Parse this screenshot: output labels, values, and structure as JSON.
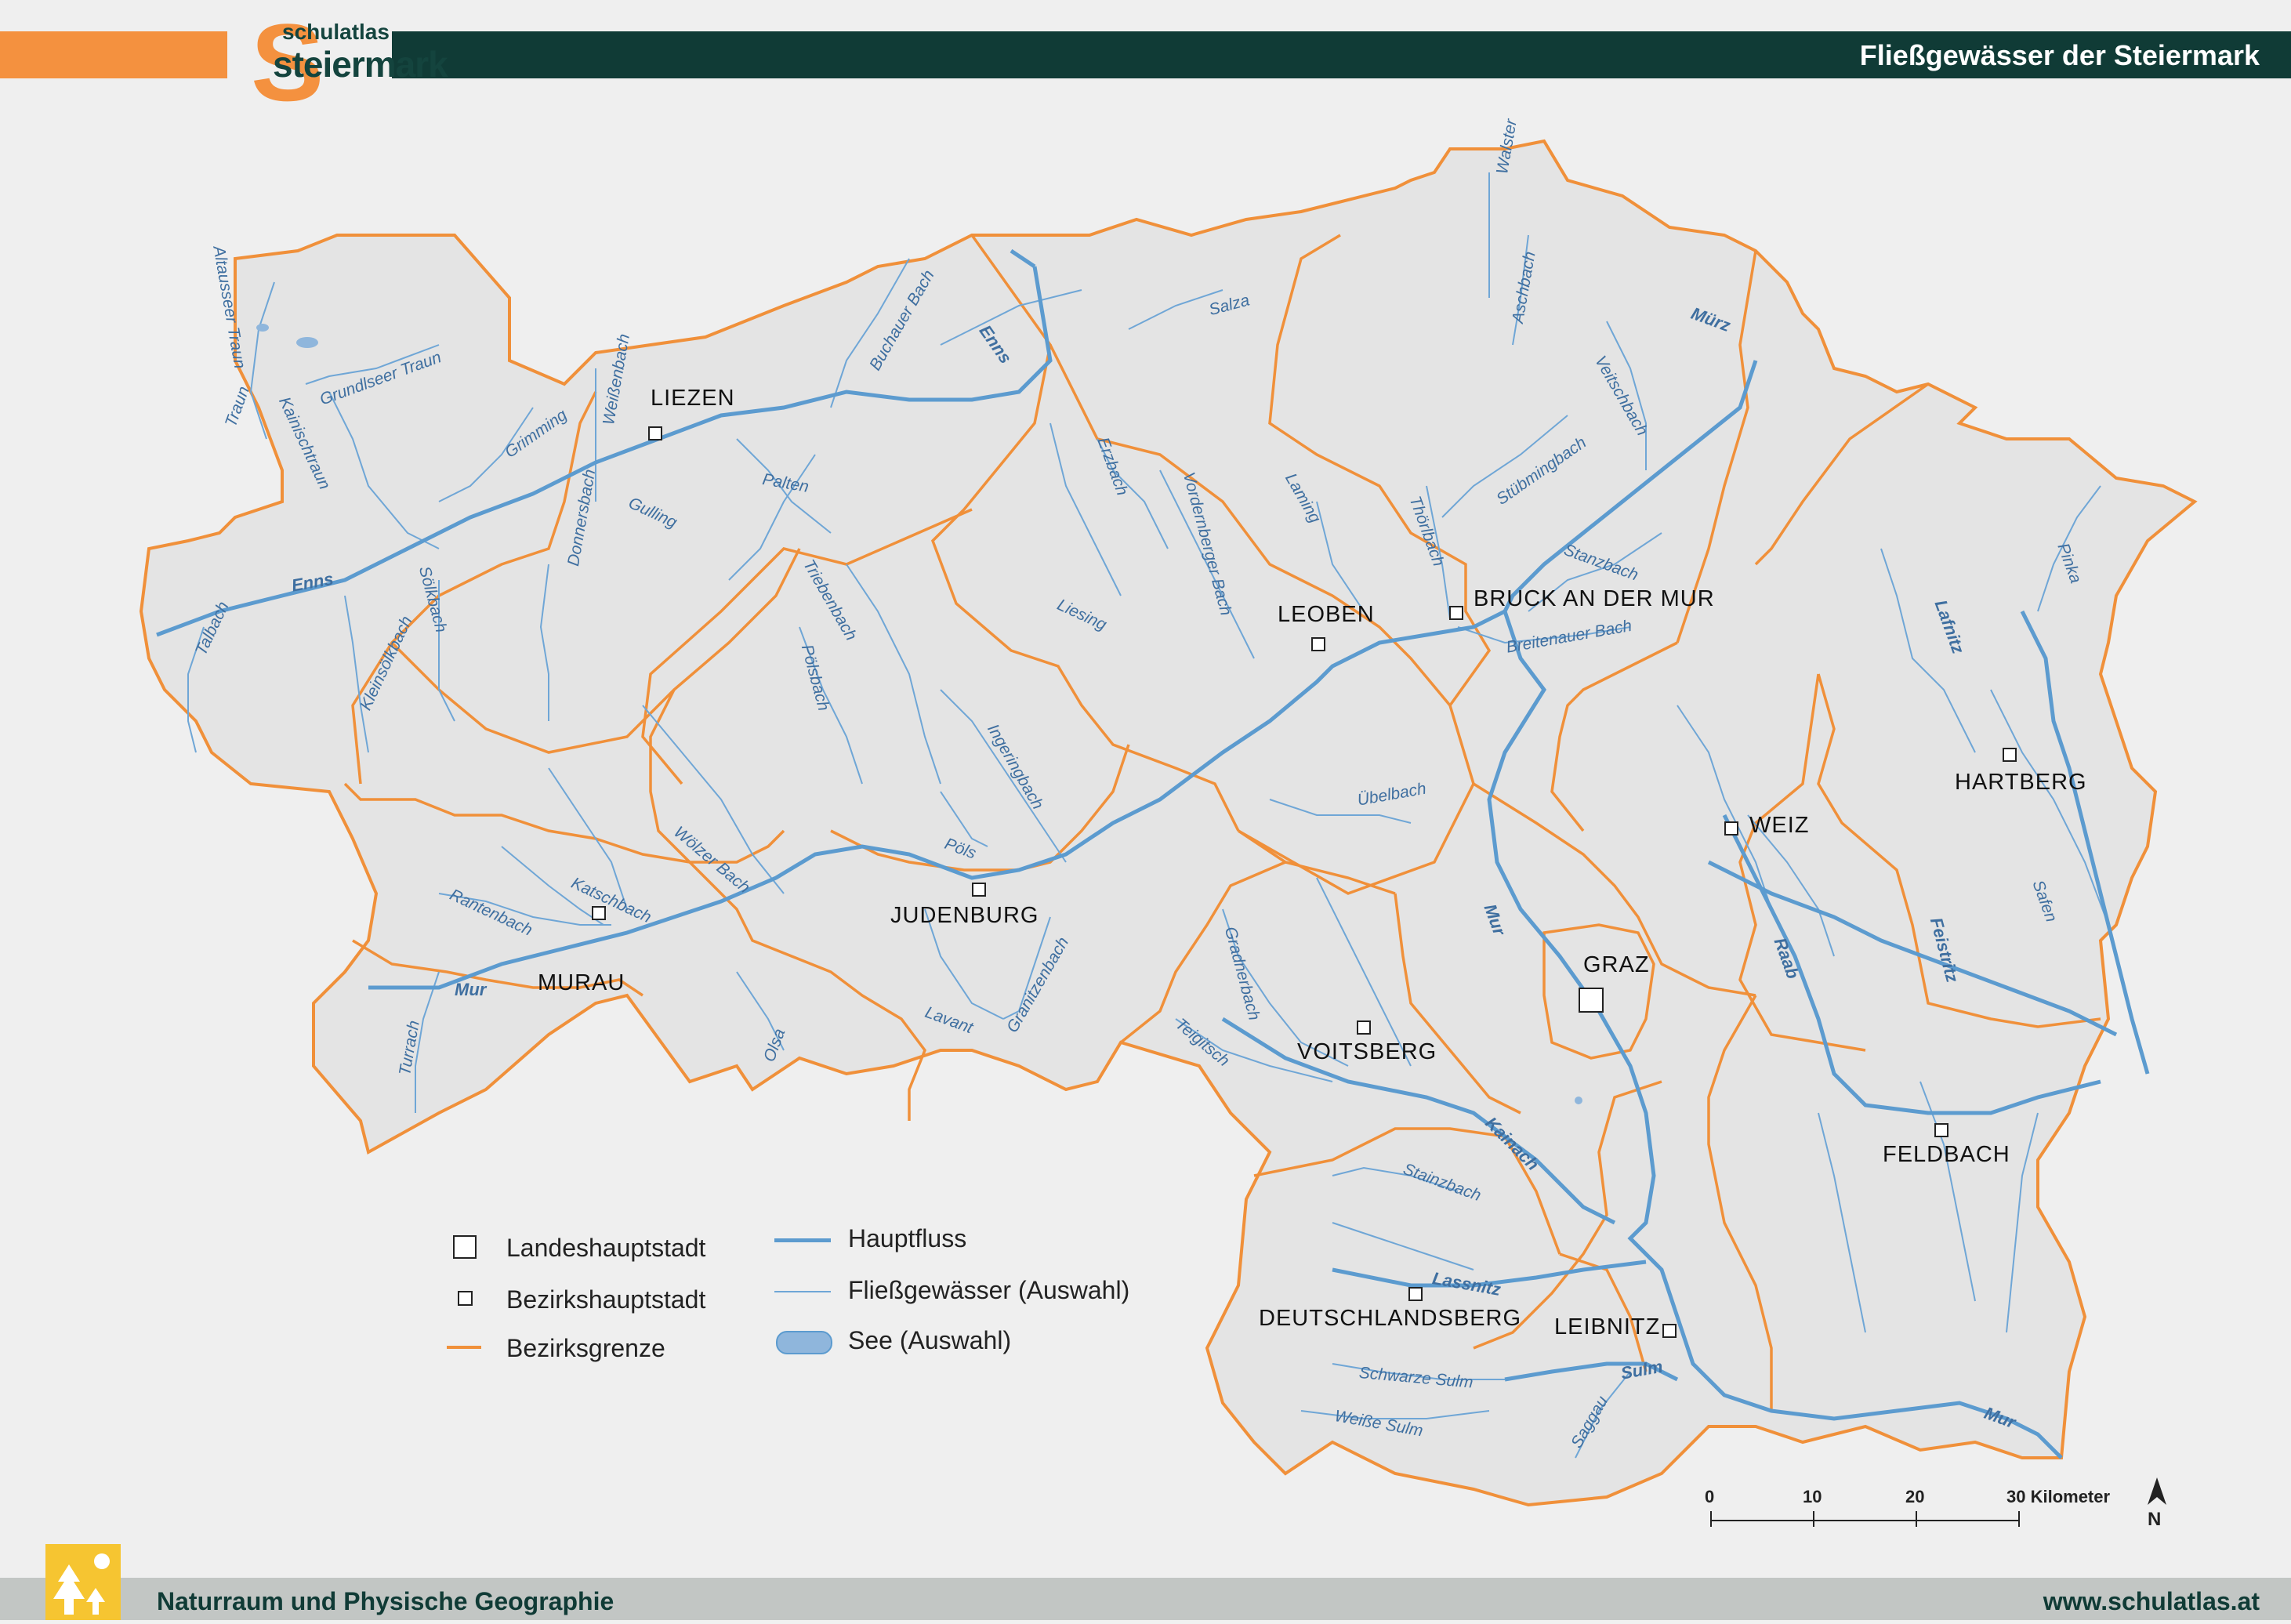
{
  "header": {
    "title": "Fließgewässer der Steiermark",
    "logo_top": "schulatlas",
    "logo_bottom": "steiermark"
  },
  "footer": {
    "left": "Naturraum und Physische Geographie",
    "right": "www.schulatlas.at"
  },
  "colors": {
    "river": "#5c9bcf",
    "district_border": "#f0903a",
    "header_dark": "#103b36",
    "header_orange": "#f4913f",
    "label": "#3f6fa0"
  },
  "cities": [
    {
      "name": "LIEZEN",
      "type": "district"
    },
    {
      "name": "LEOBEN",
      "type": "district"
    },
    {
      "name": "BRUCK AN DER MUR",
      "type": "district"
    },
    {
      "name": "HARTBERG",
      "type": "district"
    },
    {
      "name": "WEIZ",
      "type": "district"
    },
    {
      "name": "GRAZ",
      "type": "capital"
    },
    {
      "name": "JUDENBURG",
      "type": "district"
    },
    {
      "name": "MURAU",
      "type": "district"
    },
    {
      "name": "VOITSBERG",
      "type": "district"
    },
    {
      "name": "FELDBACH",
      "type": "district"
    },
    {
      "name": "DEUTSCHLANDSBERG",
      "type": "district"
    },
    {
      "name": "LEIBNITZ",
      "type": "district"
    }
  ],
  "rivers_main": [
    "Enns",
    "Mur",
    "Mürz",
    "Raab",
    "Feistritz",
    "Lafnitz",
    "Kainach",
    "Lassnitz",
    "Sulm"
  ],
  "rivers_minor": [
    "Altausseer Traun",
    "Grundlseer Traun",
    "Traun",
    "Kainischtraun",
    "Grimming",
    "Weißenbach",
    "Salza",
    "Buchauer Bach",
    "Walster",
    "Aschbach",
    "Veitschbach",
    "Stübmingbach",
    "Laming",
    "Thörlbach",
    "Stanzbach",
    "Breitenauer Bach",
    "Pinka",
    "Palten",
    "Gulling",
    "Erzbach",
    "Vordernberger Bach",
    "Liesing",
    "Triebenbach",
    "Pölsbach",
    "Ingeringbach",
    "Pöls",
    "Donnersbach",
    "Sölkbach",
    "Kleinsölkbach",
    "Talbach",
    "Wölzer Bach",
    "Katschbach",
    "Rantenbach",
    "Turrach",
    "Olsa",
    "Lavant",
    "Granitzenbach",
    "Übelbach",
    "Gradnerbach",
    "Teigitsch",
    "Stainzbach",
    "Schwarze Sulm",
    "Weiße Sulm",
    "Saggau",
    "Safen"
  ],
  "legend": {
    "capital": "Landeshauptstadt",
    "district_capital": "Bezirkshauptstadt",
    "district_border": "Bezirksgrenze",
    "main_river": "Hauptfluss",
    "river": "Fließgewässer (Auswahl)",
    "lake": "See (Auswahl)"
  },
  "scale": {
    "ticks": [
      "0",
      "10",
      "20",
      "30 Kilometer"
    ],
    "north": "N"
  }
}
